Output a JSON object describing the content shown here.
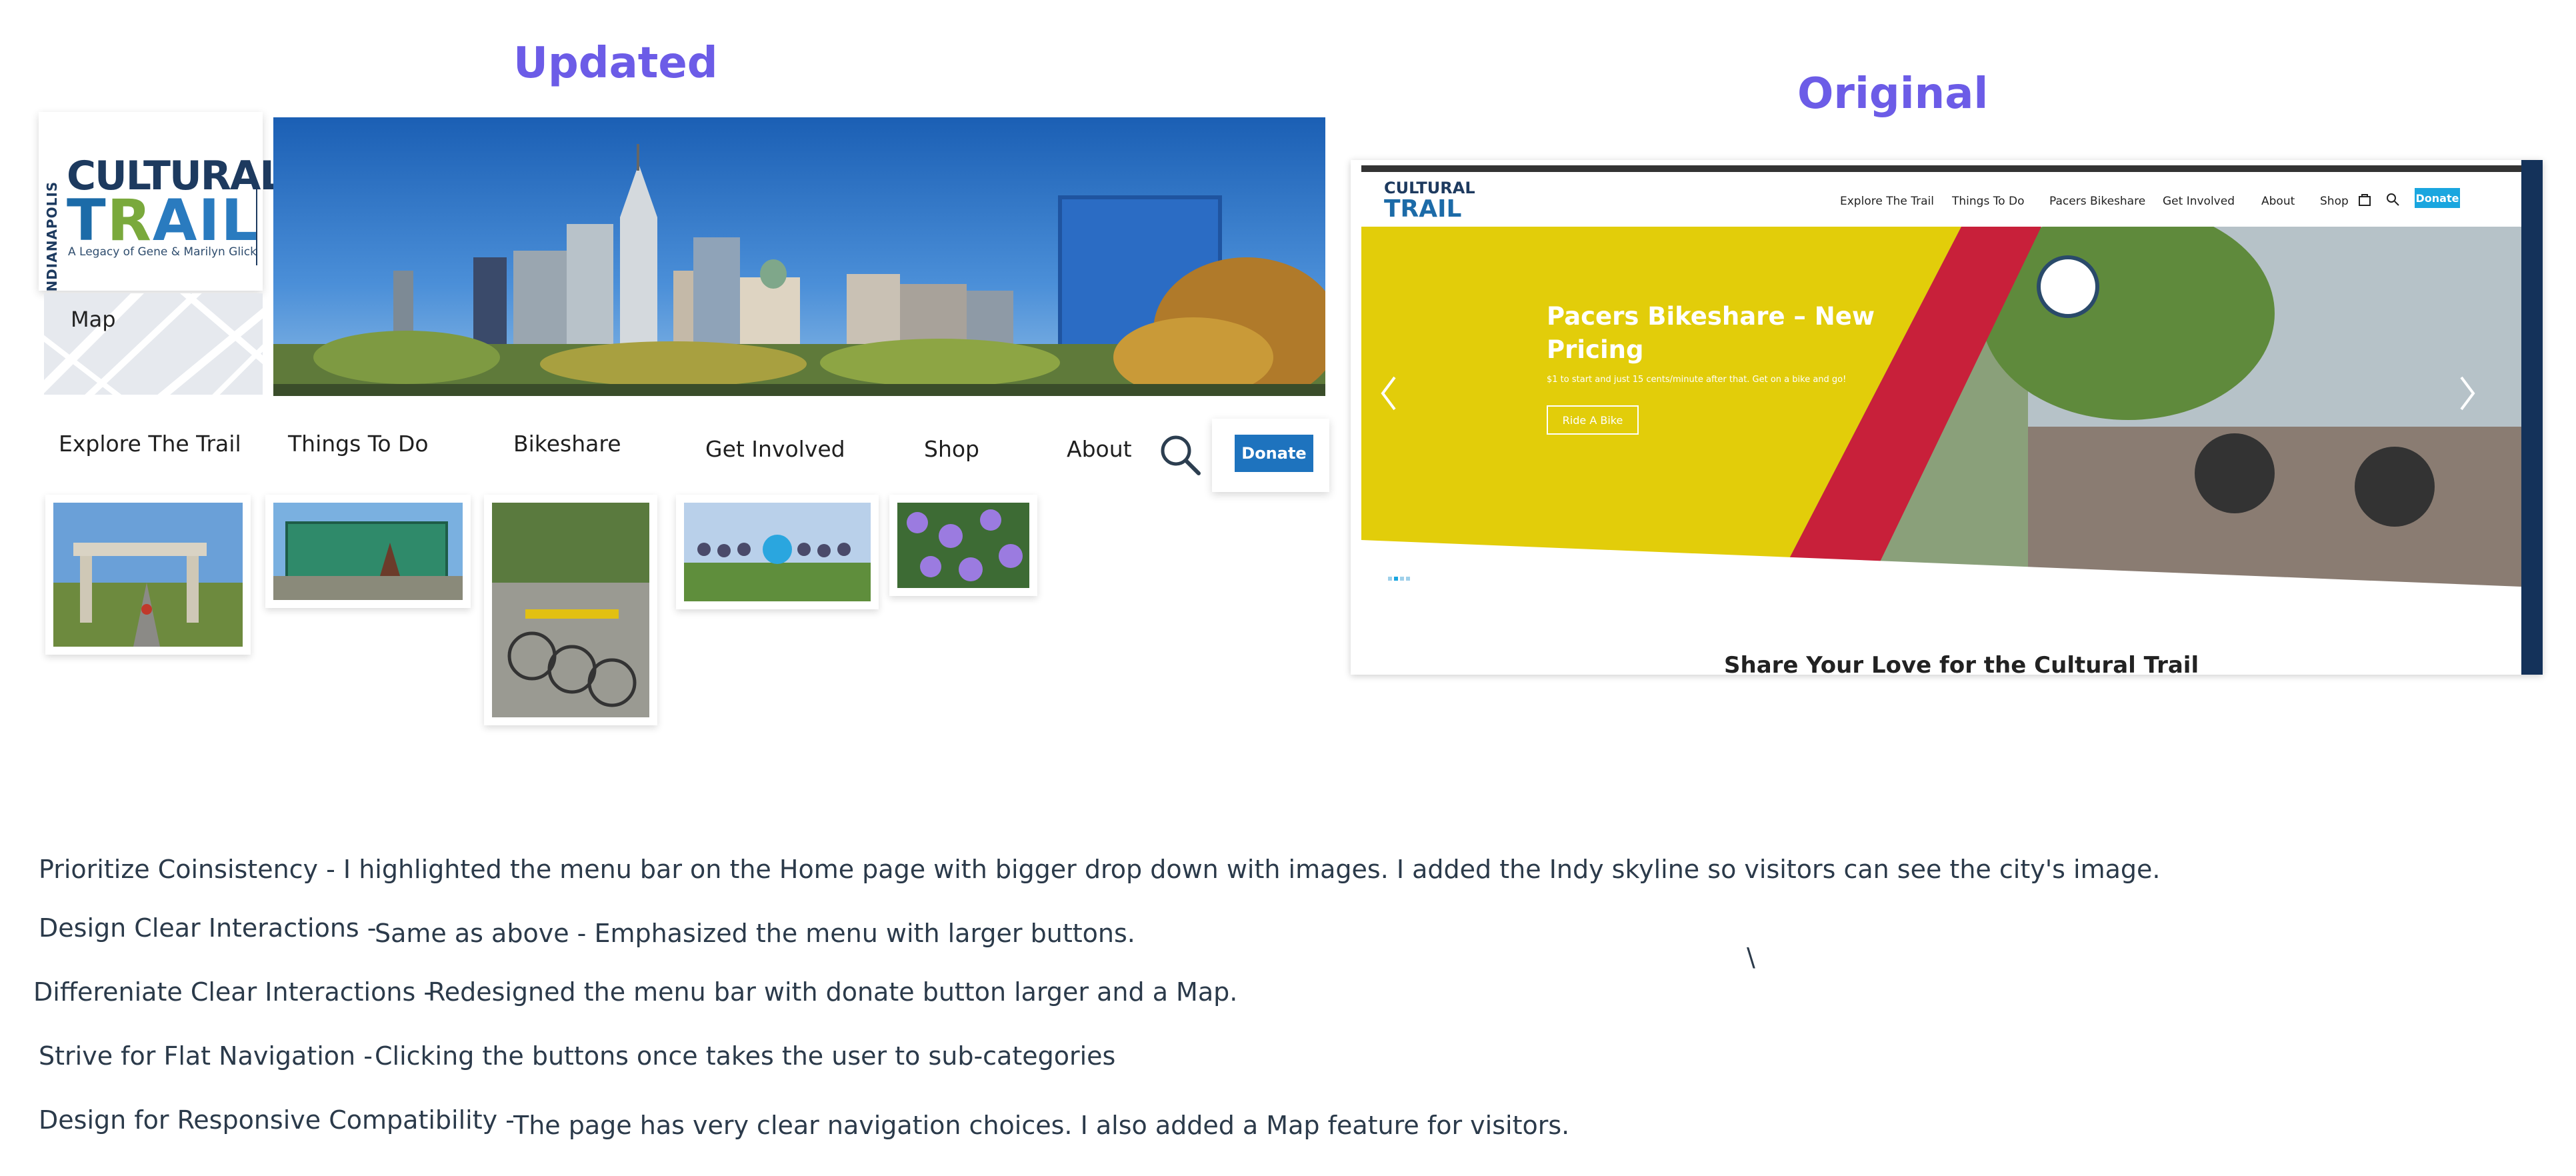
{
  "updated_heading": "Updated",
  "original_heading": "Original",
  "updated": {
    "logo": {
      "vertical_text": "INDIANAPOLIS",
      "cultural": "CULTURAL",
      "trail": [
        "T",
        "R",
        "AIL"
      ],
      "tagline": "A Legacy of Gene & Marilyn Glick"
    },
    "map_label": "Map",
    "menu": {
      "explore": "Explore The Trail",
      "things": "Things To Do",
      "bikeshare": "Bikeshare",
      "involved": "Get Involved",
      "shop": "Shop",
      "about": "About",
      "donate": "Donate"
    }
  },
  "original": {
    "logo_cultural": "CULTURAL",
    "logo_trail": "TRAIL",
    "nav": {
      "explore": "Explore The Trail",
      "things": "Things To Do",
      "pacers": "Pacers Bikeshare",
      "involved": "Get Involved",
      "about": "About",
      "shop": "Shop",
      "donate": "Donate"
    },
    "hero_title": "Pacers Bikeshare – New Pricing",
    "hero_sub": "$1 to start and just 15 cents/minute after that. Get on a bike and go!",
    "hero_button": "Ride A Bike",
    "bottom_text": "Share Your Love for the Cultural Trail"
  },
  "notes": [
    {
      "label": "Prioritize Coinsistency - I highlighted the menu bar on the Home page with bigger drop down with images. I added the Indy skyline so visitors can see the city's image.",
      "text": ""
    },
    {
      "label": "Design Clear Interactions -",
      "text": "Same as above - Emphasized the menu with larger buttons."
    },
    {
      "label": "Differeniate Clear Interactions -",
      "text": "Redesigned the menu bar with donate button larger and a Map."
    },
    {
      "label": "Strive for Flat Navigation -",
      "text": "Clicking the buttons once takes the user to sub-categories"
    },
    {
      "label": "Design for Responsive Compatibility -",
      "text": "The page has very clear navigation choices.  I also added a Map feature for visitors."
    }
  ],
  "stray_mark": "\\",
  "colors": {
    "heading": "#6c5ce7",
    "donate_updated": "#1e73be",
    "donate_original": "#1aa6df",
    "hero_yellow": "#e2cd0a"
  }
}
